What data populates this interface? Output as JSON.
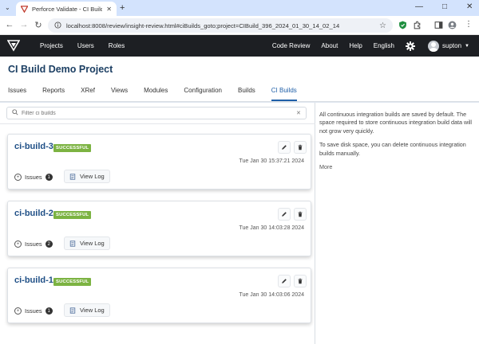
{
  "browser": {
    "tab_title": "Perforce Validate - CI Builds M...",
    "url": "localhost:8008/review/insight-review.html#ciBuilds_goto;project=CIBuild_396_2024_01_30_14_02_14"
  },
  "navbar": {
    "left_items": [
      "Projects",
      "Users",
      "Roles"
    ],
    "right_items": [
      "Code Review",
      "About",
      "Help",
      "English"
    ],
    "username": "supton"
  },
  "page": {
    "title": "CI Build Demo Project",
    "tabs": [
      "Issues",
      "Reports",
      "XRef",
      "Views",
      "Modules",
      "Configuration",
      "Builds",
      "CI Builds"
    ],
    "active_tab": "CI Builds"
  },
  "filter": {
    "placeholder": "Filter ci builds"
  },
  "builds": [
    {
      "name": "ci-build-3",
      "status": "SUCCESSFUL",
      "timestamp": "Tue Jan 30 15:37:21 2024",
      "issues_label": "Issues",
      "issues_count": "1",
      "view_log_label": "View Log"
    },
    {
      "name": "ci-build-2",
      "status": "SUCCESSFUL",
      "timestamp": "Tue Jan 30 14:03:28 2024",
      "issues_label": "Issues",
      "issues_count": "2",
      "view_log_label": "View Log"
    },
    {
      "name": "ci-build-1",
      "status": "SUCCESSFUL",
      "timestamp": "Tue Jan 30 14:03:06 2024",
      "issues_label": "Issues",
      "issues_count": "1",
      "view_log_label": "View Log"
    }
  ],
  "info": {
    "p1": "All continuous integration builds are saved by default. The space required to store continuous integration build data will not grow very quickly.",
    "p2": "To save disk space, you can delete continuous integration builds manually.",
    "more": "More"
  },
  "colors": {
    "navbar_bg": "#1d1f23",
    "badge_green": "#7cb342",
    "title_blue": "#1c3f63",
    "link_blue": "#1f4f86",
    "active_tab": "#1f5fa8"
  }
}
